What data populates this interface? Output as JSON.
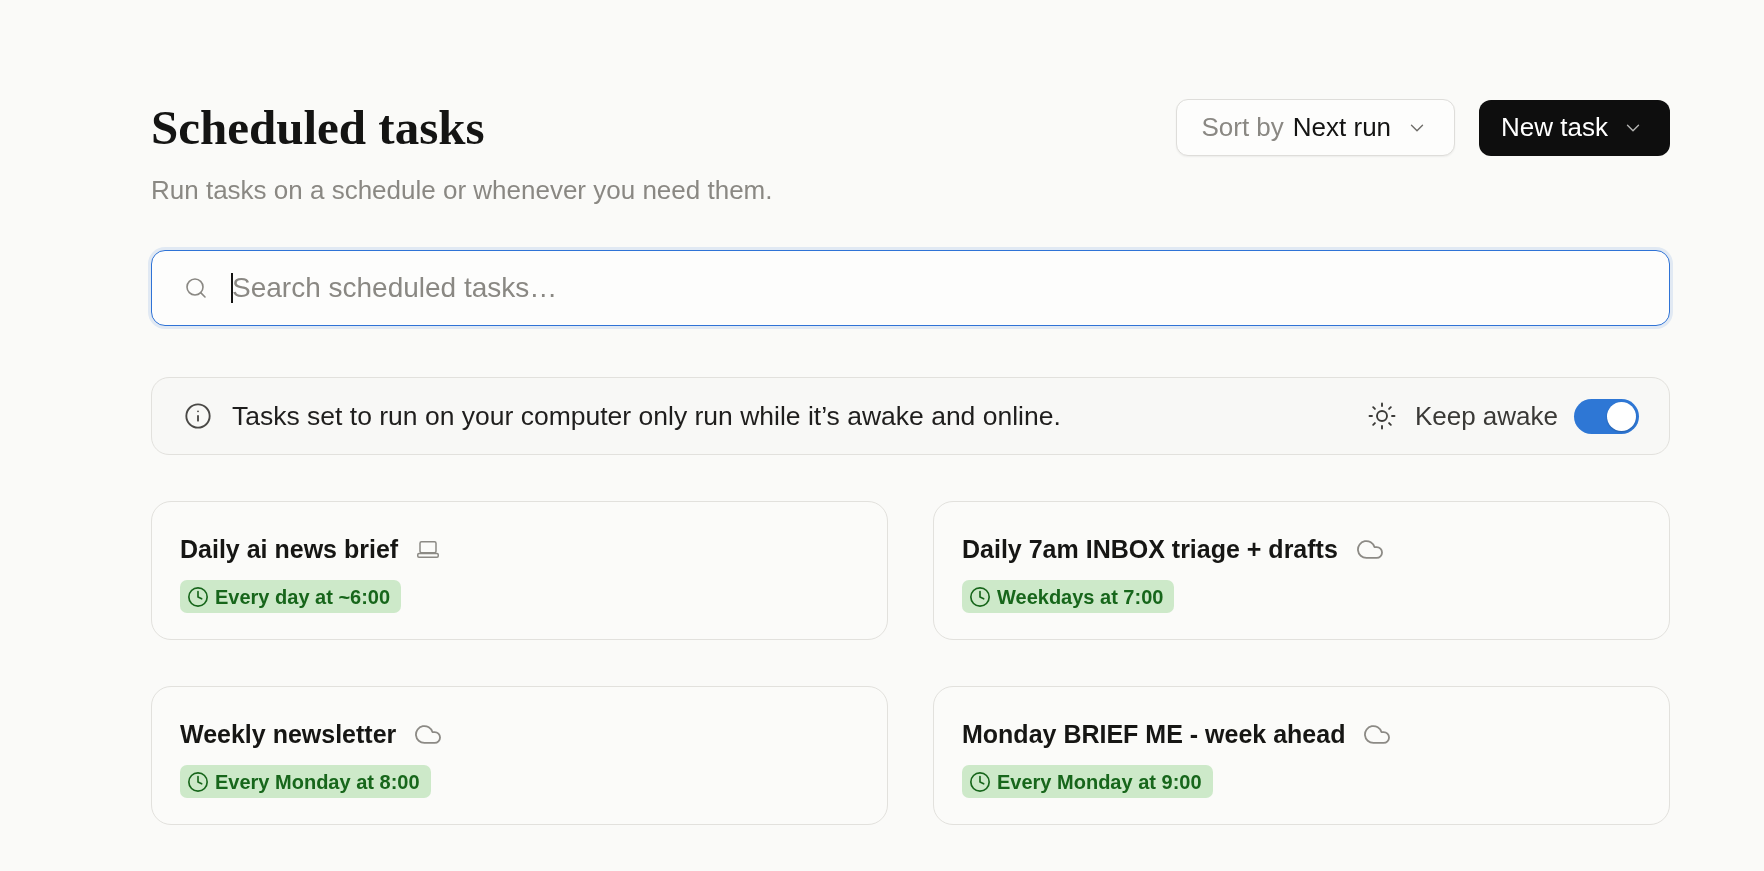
{
  "header": {
    "title": "Scheduled tasks",
    "subtitle": "Run tasks on a schedule or whenever you need them."
  },
  "sort": {
    "label": "Sort by",
    "value": "Next run"
  },
  "new_task_button": {
    "label": "New task"
  },
  "search": {
    "placeholder": "Search scheduled tasks…",
    "focused": true
  },
  "notice": {
    "text": "Tasks set to run on your computer only run while it’s awake and online.",
    "keep_awake": {
      "label": "Keep awake",
      "on": true
    }
  },
  "tasks": [
    {
      "name": "Daily ai news brief",
      "kind": "computer",
      "schedule": "Every day at ~6:00"
    },
    {
      "name": "Daily 7am INBOX triage + drafts",
      "kind": "cloud",
      "schedule": "Weekdays at 7:00"
    },
    {
      "name": "Weekly newsletter",
      "kind": "cloud",
      "schedule": "Every Monday at 8:00"
    },
    {
      "name": "Monday BRIEF ME - week ahead",
      "kind": "cloud",
      "schedule": "Every Monday at 9:00"
    }
  ]
}
